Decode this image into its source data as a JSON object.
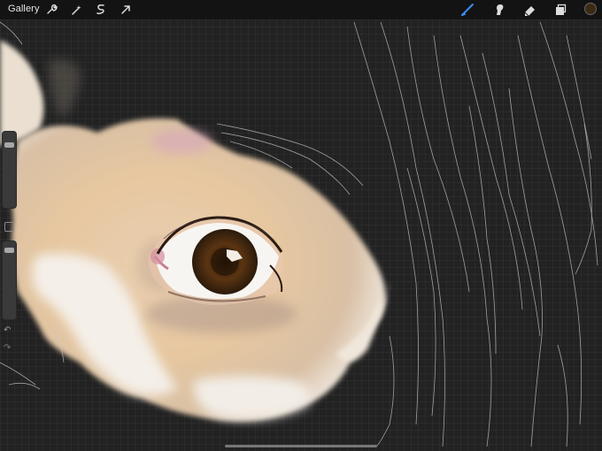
{
  "topbar": {
    "gallery_label": "Gallery",
    "left_tools": [
      {
        "name": "actions-icon"
      },
      {
        "name": "adjustments-icon"
      },
      {
        "name": "selection-icon"
      },
      {
        "name": "transform-icon"
      }
    ],
    "right_tools": [
      {
        "name": "brush-icon",
        "active": true
      },
      {
        "name": "smudge-icon"
      },
      {
        "name": "eraser-icon"
      },
      {
        "name": "layers-icon"
      }
    ],
    "current_color": "#3b2a14"
  },
  "sidebar": {
    "brush_size_level": 0.12,
    "opacity_level": 0.05
  },
  "colors": {
    "accent": "#3b8df0",
    "canvas": "#222222",
    "toolbar": "#131313"
  }
}
